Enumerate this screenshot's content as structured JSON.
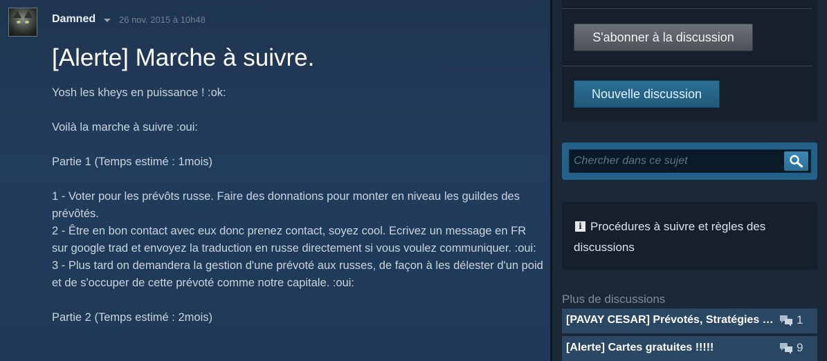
{
  "post": {
    "author": "Damned",
    "date": "26 nov. 2015 à 10h48",
    "title": "[Alerte] Marche à suivre.",
    "body": {
      "p1": "Yosh les kheys en puissance ! :ok:",
      "p2": "Voilà la marche à suivre :oui:",
      "p3": "Partie 1 (Temps estimé : 1mois)",
      "p4": "1 - Voter pour les prévôts russe. Faire des donnations pour monter en niveau les guildes des prévôtés.",
      "p5": "2 - Être en bon contact avec eux donc prenez contact, soyez cool. Ecrivez un message en FR sur google trad et envoyez la traduction en russe directement si vous voulez communiquer. :oui:",
      "p6": "3 - Plus tard on demandera la gestion d'une prévoté aux russes, de façon à les délester d'un poid et de s'occuper de cette prévoté comme notre capitale. :oui:",
      "p7": "Partie 2 (Temps estimé : 2mois)"
    }
  },
  "sidebar": {
    "subscribe_label": "S'abonner à la discussion",
    "new_discussion_label": "Nouvelle discussion",
    "search": {
      "placeholder": "Chercher dans ce sujet"
    },
    "rules_text": "Procédures à suivre et règles des discussions",
    "more_title": "Plus de discussions",
    "discussions": [
      {
        "title": "[PAVAY CESAR] Prévotés, Stratégies et Gestion",
        "count": "1"
      },
      {
        "title": "[Alerte] Cartes gratuites !!!!!",
        "count": "9"
      }
    ]
  },
  "icons": {
    "author_menu": "chevron-down-icon",
    "search": "magnifier-icon",
    "info": "info-icon",
    "comments": "speech-bubbles-icon"
  },
  "colors": {
    "subscribe_button": "#5a5f67",
    "new_discussion_button": "#2a6f93",
    "search_frame": "#23608a",
    "discussion_item": "#2a4763"
  }
}
